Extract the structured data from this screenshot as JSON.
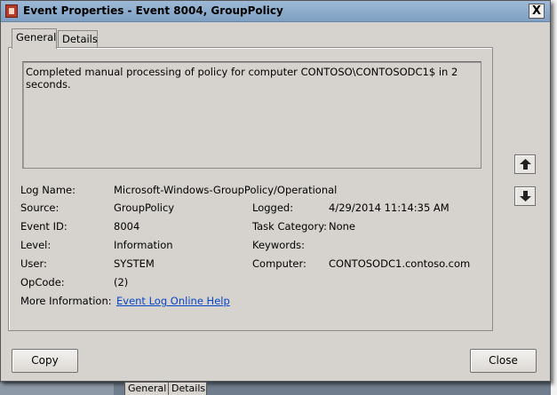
{
  "window": {
    "title": "Event Properties - Event 8004, GroupPolicy",
    "close_label": "X"
  },
  "tabs": [
    {
      "label": "General",
      "active": true
    },
    {
      "label": "Details",
      "active": false
    }
  ],
  "description": "Completed manual processing of policy for computer CONTOSO\\CONTOSODC1$ in 2 seconds.",
  "fields": {
    "log_name": {
      "label": "Log Name:",
      "value": "Microsoft-Windows-GroupPolicy/Operational"
    },
    "source": {
      "label": "Source:",
      "value": "GroupPolicy"
    },
    "logged": {
      "label": "Logged:",
      "value": "4/29/2014 11:14:35 AM"
    },
    "event_id": {
      "label": "Event ID:",
      "value": "8004"
    },
    "task_category": {
      "label": "Task Category:",
      "value": "None"
    },
    "level": {
      "label": "Level:",
      "value": "Information"
    },
    "keywords": {
      "label": "Keywords:",
      "value": ""
    },
    "user": {
      "label": "User:",
      "value": "SYSTEM"
    },
    "computer": {
      "label": "Computer:",
      "value": "CONTOSODC1.contoso.com"
    },
    "opcode": {
      "label": "OpCode:",
      "value": "(2)"
    },
    "more_info": {
      "label": "More Information:",
      "link": "Event Log Online Help"
    }
  },
  "nav": {
    "up_icon": "arrow-up-icon",
    "down_icon": "arrow-down-icon"
  },
  "buttons": {
    "copy": "Copy",
    "close": "Close"
  },
  "background_tabs": [
    {
      "label": "General"
    },
    {
      "label": "Details"
    }
  ],
  "colors": {
    "dialog_bg": "#d6d3ce",
    "titlebar": "#8fadcd",
    "link": "#0645c6"
  }
}
